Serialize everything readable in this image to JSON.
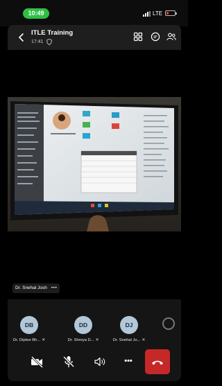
{
  "status_bar": {
    "time": "10:49",
    "network": "LTE",
    "battery_color": "#e53935"
  },
  "header": {
    "title": "ITLE Training",
    "timer": "17:41",
    "icons": [
      "back-icon",
      "shield-icon",
      "grid-view-icon",
      "chat-icon",
      "participants-icon"
    ]
  },
  "main": {
    "speaker_name": "Dr. Snehal Josh",
    "speaker_more": "•••"
  },
  "participants": [
    {
      "initials": "DB",
      "name": "Dr. Diptee Bh...",
      "muted": true
    },
    {
      "initials": "DD",
      "name": "Dr. Shreya D...",
      "muted": true
    },
    {
      "initials": "DJ",
      "name": "Dr. Snehal Jo...",
      "muted": true
    }
  ],
  "controls": {
    "more_label": "•••",
    "icons": [
      "camera-off-icon",
      "mic-off-icon",
      "speaker-icon",
      "more-icon",
      "end-call-icon"
    ],
    "end_call_color": "#c62828"
  }
}
